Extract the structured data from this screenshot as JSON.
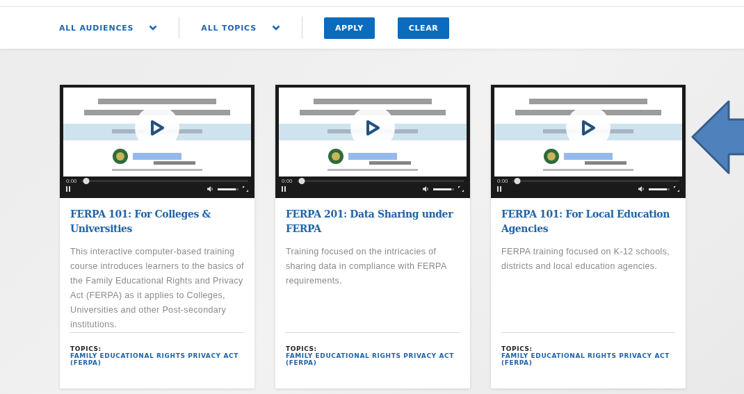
{
  "filters": [
    {
      "label": "ALL AUDIENCES"
    },
    {
      "label": "ALL TOPICS"
    }
  ],
  "buttons": [
    {
      "label": "APPLY"
    },
    {
      "label": "CLEAR"
    }
  ],
  "cards": [
    {
      "video": {
        "kind": "picture",
        "time": "0:00",
        "progress": {
          "level": 0.03
        },
        "volume": {
          "level": 0.85
        }
      },
      "title": "FERPA 101: For Colleges & Universities",
      "description": "This interactive computer-based training course introduces learners to the basics of the Family Educational Rights and Privacy Act (FERPA) as it applies to Colleges, Universities and other Post-secondary institutions.",
      "topics_label": "TOPICS:",
      "topics": "FAMILY EDUCATIONAL RIGHTS PRIVACY ACT (FERPA)"
    },
    {
      "video": {
        "kind": "picture",
        "time": "0:00",
        "progress": {
          "level": 0.03
        },
        "volume": {
          "level": 0.85
        }
      },
      "title": "FERPA 201: Data Sharing under FERPA",
      "description": "Training focused on the intricacies of sharing data in compliance with FERPA requirements.",
      "topics_label": "TOPICS:",
      "topics": "FAMILY EDUCATIONAL RIGHTS PRIVACY ACT (FERPA)"
    },
    {
      "video": {
        "kind": "picture",
        "time": "0:00",
        "progress": {
          "level": 0.03
        },
        "volume": {
          "level": 0.85
        }
      },
      "title": "FERPA 101: For Local Education Agencies",
      "description": "FERPA training focused on K-12 schools, districts and local education agencies.",
      "topics_label": "TOPICS:",
      "topics": "FAMILY EDUCATIONAL RIGHTS PRIVACY ACT (FERPA)"
    }
  ],
  "annotation": {
    "kind": "arrow",
    "color": "#4f81bd"
  }
}
